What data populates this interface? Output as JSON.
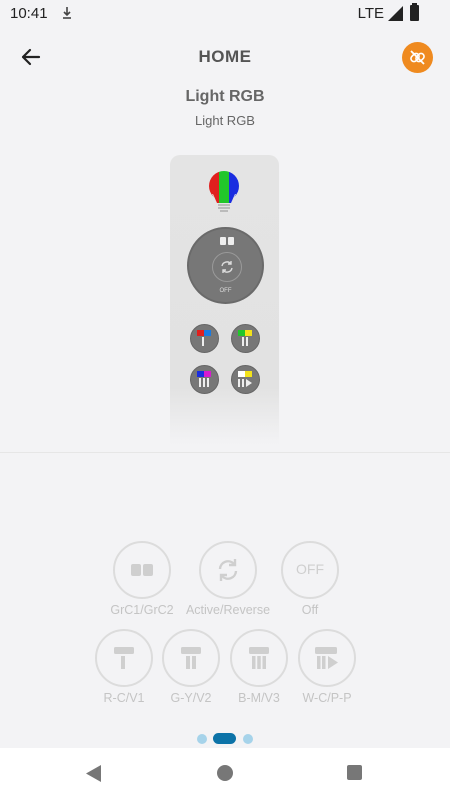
{
  "status_bar": {
    "time": "10:41",
    "network": "LTE"
  },
  "header": {
    "title": "HOME"
  },
  "device": {
    "name": "Light RGB",
    "subtitle": "Light RGB"
  },
  "remote": {
    "off_label": "OFF"
  },
  "controls": {
    "grc": "GrC1/GrC2",
    "active_reverse": "Active/Reverse",
    "off_text": "OFF",
    "off": "Off",
    "rc_v1": "R-C/V1",
    "gy_v2": "G-Y/V2",
    "bm_v3": "B-M/V3",
    "wc_pp": "W-C/P-P"
  },
  "pager": {
    "pages": 3,
    "active_index": 1
  },
  "colors": {
    "accent": "#ef8a1f",
    "pager_active": "#0c73a8",
    "pager_inactive": "#a6d3ea"
  },
  "icons": [
    "arrow-back-icon",
    "link-off-icon",
    "bulb-icon",
    "refresh-icon",
    "nav-back-icon",
    "nav-home-icon",
    "nav-recent-icon"
  ]
}
